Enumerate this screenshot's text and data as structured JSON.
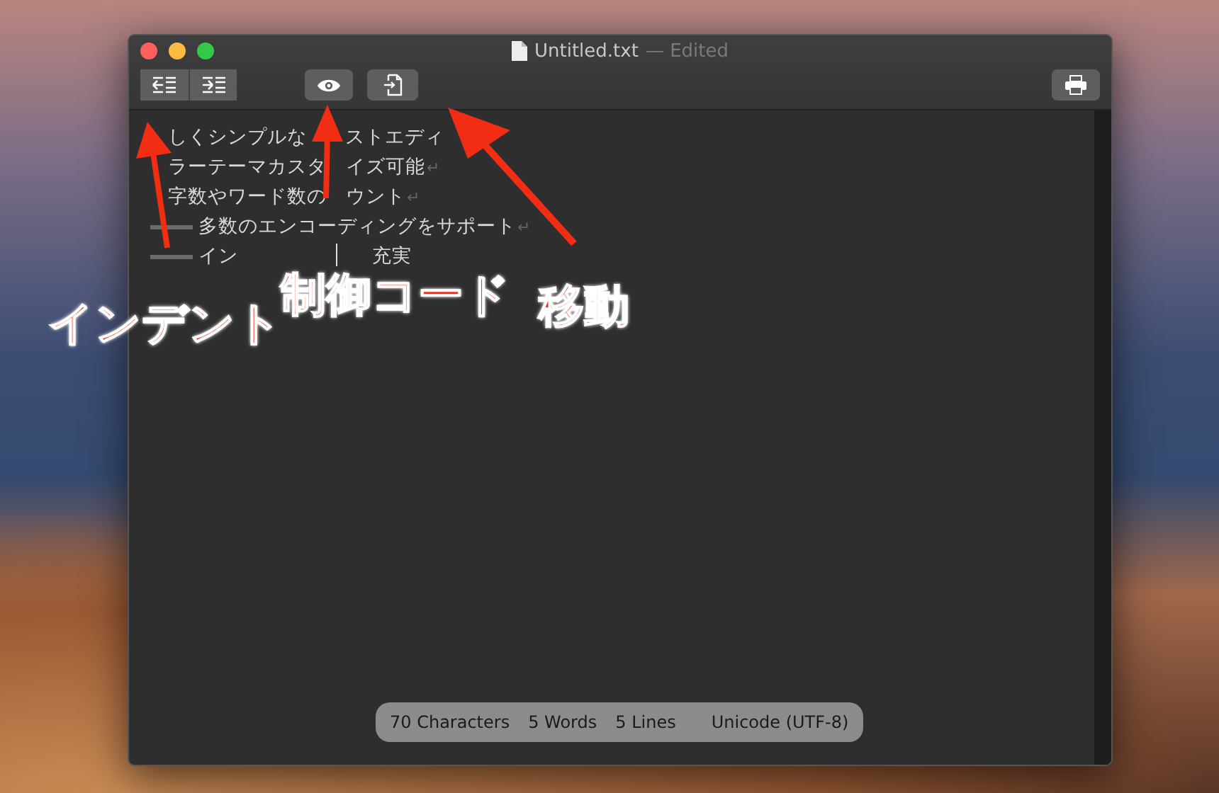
{
  "window": {
    "title": "Untitled.txt",
    "title_suffix": "— Edited"
  },
  "lines": [
    {
      "kind": "plain",
      "segments": [
        "しくシンプルな",
        "ストエディ"
      ]
    },
    {
      "kind": "plain",
      "segments": [
        "ラーテーマカスタ",
        "イズ可能"
      ],
      "end_mark": "↵"
    },
    {
      "kind": "plain",
      "segments": [
        "字数やワード数の",
        "ウント"
      ],
      "end_mark": "↵"
    },
    {
      "kind": "tabbed",
      "segments": [
        "多数のエンコーディングをサポート"
      ],
      "end_mark": "↵"
    },
    {
      "kind": "tabbed",
      "segments": [
        "イン",
        "充実"
      ]
    }
  ],
  "status_bar": [
    "70 Characters",
    "5 Words",
    "5 Lines",
    "Unicode (UTF-8)"
  ],
  "annotations": [
    {
      "label": "インデント"
    },
    {
      "label": "制御コード"
    },
    {
      "label": "移動"
    }
  ]
}
